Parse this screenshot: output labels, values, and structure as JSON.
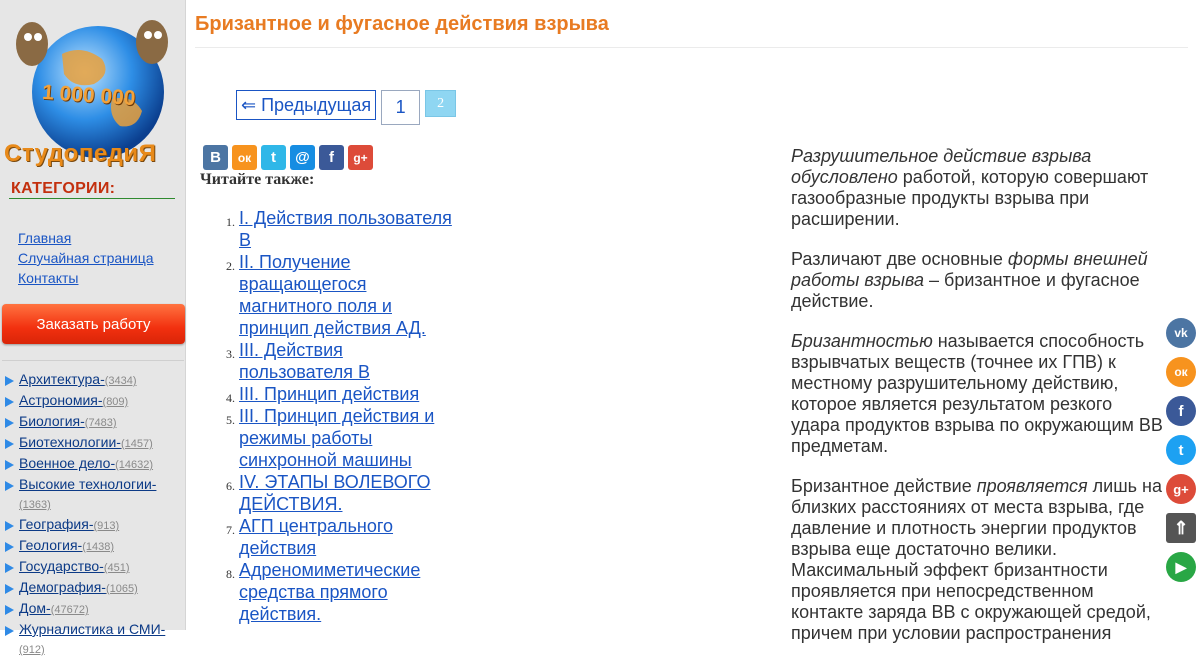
{
  "logo": {
    "number": "1 000 000",
    "name": "СтудопедиЯ"
  },
  "sidebar": {
    "categories_title": "КАТЕГОРИИ:",
    "nav": [
      {
        "label": "Главная"
      },
      {
        "label": "Случайная страница"
      },
      {
        "label": "Контакты"
      }
    ],
    "order_button": "Заказать работу",
    "categories": [
      {
        "name": "Архитектура-",
        "count": "(3434)"
      },
      {
        "name": "Астрономия-",
        "count": "(809)"
      },
      {
        "name": "Биология-",
        "count": "(7483)"
      },
      {
        "name": "Биотехнологии-",
        "count": "(1457)"
      },
      {
        "name": "Военное дело-",
        "count": "(14632)"
      },
      {
        "name": "Высокие технологии-",
        "count": "(1363)"
      },
      {
        "name": "География-",
        "count": "(913)"
      },
      {
        "name": "Геология-",
        "count": "(1438)"
      },
      {
        "name": "Государство-",
        "count": "(451)"
      },
      {
        "name": "Демография-",
        "count": "(1065)"
      },
      {
        "name": "Дом-",
        "count": "(47672)"
      },
      {
        "name": "Журналистика и СМИ-",
        "count": "(912)"
      }
    ]
  },
  "header": {
    "title": "Бризантное и фугасное действия взрыва"
  },
  "pager": {
    "prev": "⇐ Предыдущая",
    "page1": "1",
    "page2": "2"
  },
  "share": [
    "В",
    "ок",
    "t",
    "@",
    "f",
    "g+"
  ],
  "read_also": "Читайте также:",
  "links": [
    {
      "num": "1.",
      "text": "I. Действия пользователя В"
    },
    {
      "num": "2.",
      "text": "II. Получение вращающегося магнитного поля и принцип действия АД."
    },
    {
      "num": "3.",
      "text": "III. Действия пользователя В"
    },
    {
      "num": "4.",
      "text": "III. Принцип действия"
    },
    {
      "num": "5.",
      "text": "III. Принцип действия и режимы работы синхронной машины"
    },
    {
      "num": "6.",
      "text": "IV. ЭТАПЫ ВОЛЕВОГО ДЕЙСТВИЯ."
    },
    {
      "num": "7.",
      "text": "АГП центрального действия"
    },
    {
      "num": "8.",
      "text": "Адреномиметические средства прямого действия."
    }
  ],
  "article": {
    "p1_em": "Разрушительное действие взрыва обусловлено",
    "p1": " работой, которую совершают газообразные продукты взрыва при расширении.",
    "p2_a": "Различают две основные ",
    "p2_em": "формы внешней работы взрыва",
    "p2_b": " – бризантное и фугасное действие.",
    "p3_em": "Бризантностью",
    "p3": " называется способность взрывчатых веществ (точнее их ГПВ) к местному разрушительному действию, которое является результатом резкого удара продуктов взрыва по окружающим ВВ предметам.",
    "p4_a": "Бризантное действие ",
    "p4_em": "проявляется",
    "p4_b": " лишь на близких расстояниях от места взрыва, где давление и плотность энергии продуктов взрыва еще достаточно велики. Максимальный эффект бризантности проявляется при непосредственном контакте заряда ВВ с окружающей средой, причем при условии распространения"
  },
  "floats": [
    {
      "glyph": "vk",
      "color": "#4c75a3"
    },
    {
      "glyph": "ок",
      "color": "#f7931e"
    },
    {
      "glyph": "f",
      "color": "#3b5998"
    },
    {
      "glyph": "t",
      "color": "#1da1f2"
    },
    {
      "glyph": "g+",
      "color": "#dd4b39"
    },
    {
      "glyph": "⇑",
      "color": "#555555"
    },
    {
      "glyph": "▶",
      "color": "#29a745"
    }
  ]
}
